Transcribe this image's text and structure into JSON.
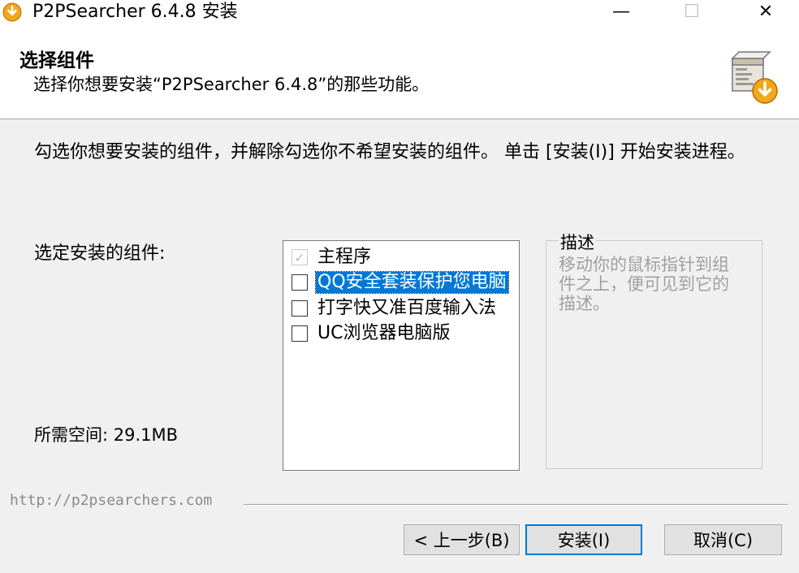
{
  "window": {
    "title": "P2PSearcher 6.4.8 安装",
    "minimize_glyph": "—",
    "maximize_glyph": "☐",
    "close_glyph": "✕"
  },
  "header": {
    "title": "选择组件",
    "subtitle": "选择你想要安装“P2PSearcher 6.4.8”的那些功能。"
  },
  "intro_text": "勾选你想要安装的组件，并解除勾选你不希望安装的组件。 单击 [安装(I)] 开始安装进程。",
  "components_label": "选定安装的组件:",
  "space_required": "所需空间: 29.1MB",
  "components": [
    {
      "label": "主程序",
      "checked": true,
      "disabled": true,
      "selected": false
    },
    {
      "label": "QQ安全套装保护您电脑",
      "checked": false,
      "disabled": false,
      "selected": true
    },
    {
      "label": "打字快又准百度输入法",
      "checked": false,
      "disabled": false,
      "selected": false
    },
    {
      "label": "UC浏览器电脑版",
      "checked": false,
      "disabled": false,
      "selected": false
    }
  ],
  "description": {
    "legend": "描述",
    "text": "移动你的鼠标指针到组件之上，便可见到它的描述。"
  },
  "footer": {
    "url": "http://p2psearchers.com"
  },
  "buttons": {
    "back": "< 上一步(B)",
    "install": "安装(I)",
    "cancel": "取消(C)"
  },
  "colors": {
    "accent": "#0078d7",
    "window_bg": "#f0f0f0",
    "disabled_text": "#a0a0a0"
  },
  "icons": {
    "app": "download-arrow-icon",
    "header": "installer-box-icon",
    "check": "checkmark-icon"
  }
}
